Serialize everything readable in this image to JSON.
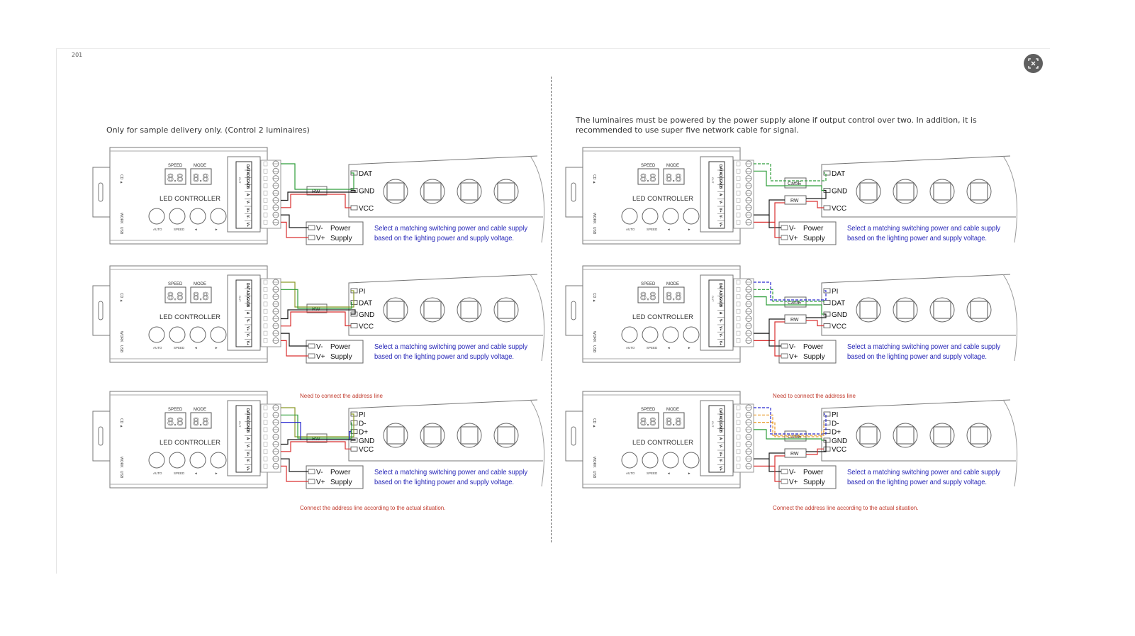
{
  "page": {
    "page_number": "201",
    "fullscreen_icon": "fullscreen-exit-icon"
  },
  "captions": {
    "left": "Only for sample delivery only. (Control 2 luminaires)",
    "right": "The luminaires must be powered by the power supply alone if output control over two. In addition, it is recommended to use super five network cable for signal."
  },
  "controller": {
    "title": "LED CONTROLLER",
    "display_labels": [
      "SPEED",
      "MODE"
    ],
    "button_labels": [
      "AUTO",
      "SPEED",
      "◄",
      "►"
    ],
    "side_labels": [
      "CD ▲",
      "WORK",
      "USB"
    ],
    "terminal_labels": [
      "DAT",
      "ADD",
      "GND",
      "B",
      "A",
      "V-",
      "V+",
      "V-",
      "V+"
    ],
    "terminal_group_labels": [
      "OUT",
      "DC OUT 12-24V",
      "DC IN 12-24V"
    ]
  },
  "power_supply": {
    "terminals": [
      "V-",
      "V+"
    ],
    "label_line1": "Power",
    "label_line2": "Supply"
  },
  "note": {
    "line1": "Select a matching switching power and cable supply",
    "line2": "based on the lighting power and supply voltage."
  },
  "colors": {
    "note_blue": "#1f1fb5",
    "annotation_red": "#c0392b",
    "wire_green": "#2e9e3a",
    "wire_olive": "#8a9a2a",
    "wire_black": "#1a1a1a",
    "wire_red": "#d93030",
    "wire_blue": "#2a2ad0",
    "wire_orange": "#e89a2a"
  },
  "diagrams": [
    {
      "id": "left-1",
      "column": "left",
      "cable_box": null,
      "resistor_label": "RW",
      "annotation": "",
      "pins": [
        "DAT",
        "GND",
        "VCC"
      ],
      "pixels": 4
    },
    {
      "id": "left-2",
      "column": "left",
      "cable_box": null,
      "resistor_label": "RW",
      "annotation": "Need to connect the address line",
      "pins": [
        "PI",
        "DAT",
        "GND",
        "VCC"
      ],
      "pixels": 4
    },
    {
      "id": "left-3",
      "column": "left",
      "cable_box": null,
      "resistor_label": "RW",
      "annotation": "Connect the address line according to the actual situation.",
      "pins": [
        "PI",
        "D-",
        "D+",
        "GND",
        "VCC"
      ],
      "pixels": 4
    },
    {
      "id": "right-1",
      "column": "right",
      "cable_box": "Cat5E",
      "resistor_label": "RW",
      "annotation": "",
      "pins": [
        "DAT",
        "GND",
        "VCC"
      ],
      "pixels": 4
    },
    {
      "id": "right-2",
      "column": "right",
      "cable_box": "Cat5E",
      "resistor_label": "RW",
      "annotation": "Need to connect the address line",
      "pins": [
        "PI",
        "DAT",
        "GND",
        "VCC"
      ],
      "pixels": 4
    },
    {
      "id": "right-3",
      "column": "right",
      "cable_box": "Cat5E",
      "resistor_label": "RW",
      "annotation": "Connect the address line according to the actual situation.",
      "pins": [
        "PI",
        "D-",
        "D+",
        "GND",
        "VCC"
      ],
      "pixels": 4
    }
  ]
}
